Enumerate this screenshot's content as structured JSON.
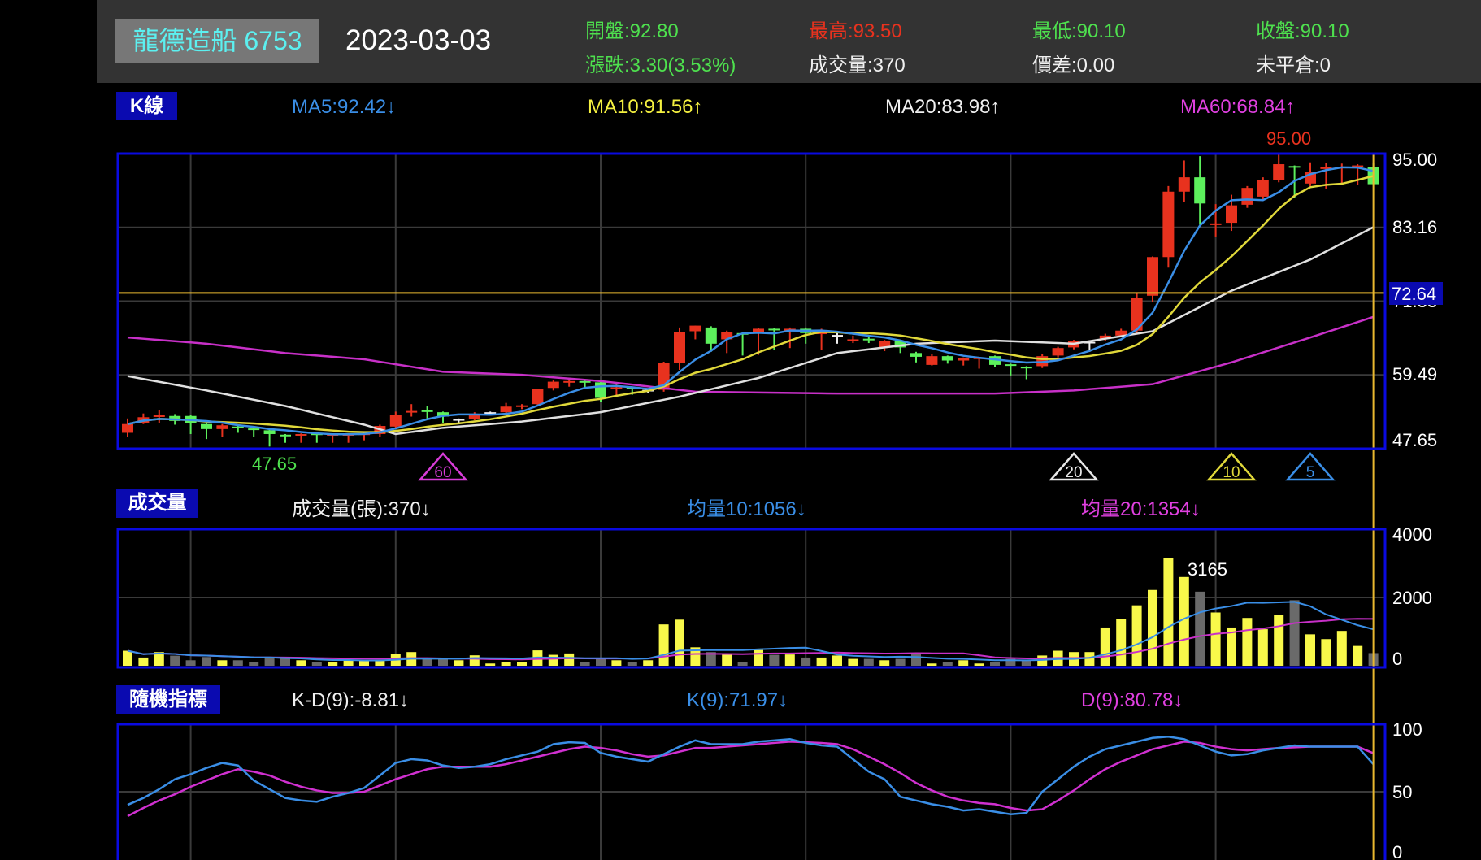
{
  "header": {
    "name": "龍德造船 6753",
    "date": "2023-03-03",
    "open": "開盤:92.80",
    "change": "漲跌:3.30(3.53%)",
    "high": "最高:93.50",
    "volume": "成交量:370",
    "low": "最低:90.10",
    "spread": "價差:0.00",
    "close": "收盤:90.10",
    "open_interest": "未平倉:0"
  },
  "kline_panel": {
    "tab": "K線",
    "ma5": "MA5:92.42↓",
    "ma10": "MA10:91.56↑",
    "ma20": "MA20:83.98↑",
    "ma60": "MA60:68.84↑",
    "y_ticks": [
      "95.00",
      "83.16",
      "71.33",
      "59.49",
      "47.65"
    ],
    "crosshair_value": "72.64",
    "max_label": "95.00",
    "min_label": "47.65",
    "markers": [
      {
        "label": "60",
        "index": 20,
        "color": "#d83cd8"
      },
      {
        "label": "20",
        "index": 60,
        "color": "#e8e8e8"
      },
      {
        "label": "10",
        "index": 70,
        "color": "#e0d83a"
      },
      {
        "label": "5",
        "index": 75,
        "color": "#3a8ee6"
      }
    ]
  },
  "volume_panel": {
    "tab": "成交量",
    "vol": "成交量(張):370↓",
    "avg10": "均量10:1056↓",
    "avg20": "均量20:1354↓",
    "y_ticks": [
      "4000",
      "2000",
      "0"
    ],
    "peak_label": "3165"
  },
  "kd_panel": {
    "tab": "隨機指標",
    "kd_diff": "K-D(9):-8.81↓",
    "k": "K(9):71.97↓",
    "d": "D(9):80.78↓",
    "y_ticks": [
      "100",
      "50",
      "0"
    ]
  },
  "colors": {
    "up": "#e8321e",
    "down": "#5cf05c",
    "flat": "#f0f0f0",
    "ma5": "#3a8ee6",
    "ma10": "#e0d83a",
    "ma20": "#e0e0e0",
    "ma60": "#c830c8",
    "vol_up": "#f8f84a",
    "vol_down": "#6a6a6a",
    "crosshair": "#e8b830",
    "frame": "#0a0ae0",
    "grid": "#3a3a3a"
  },
  "chart_data": {
    "type": "candlestick",
    "price_range": [
      47.65,
      95.0
    ],
    "crosshair_price": 72.64,
    "candles": [
      [
        50.2,
        52.5,
        49.5,
        51.6
      ],
      [
        51.8,
        53.3,
        51.6,
        52.7
      ],
      [
        52.8,
        53.8,
        51.7,
        53.0
      ],
      [
        52.9,
        53.2,
        51.5,
        52.1
      ],
      [
        52.9,
        53.1,
        50.0,
        51.8
      ],
      [
        51.6,
        51.8,
        49.2,
        50.8
      ],
      [
        50.8,
        51.6,
        49.5,
        51.4
      ],
      [
        51.2,
        51.3,
        50.2,
        51.0
      ],
      [
        50.9,
        51.0,
        49.6,
        50.8
      ],
      [
        50.6,
        50.7,
        48.0,
        50.0
      ],
      [
        49.9,
        50.0,
        48.6,
        49.8
      ],
      [
        49.8,
        50.1,
        48.6,
        50.0
      ],
      [
        50.1,
        50.2,
        48.6,
        50.0
      ],
      [
        49.9,
        50.1,
        48.6,
        50.0
      ],
      [
        49.9,
        50.1,
        48.6,
        50.0
      ],
      [
        49.9,
        50.2,
        49.0,
        50.1
      ],
      [
        50.0,
        51.5,
        49.6,
        51.3
      ],
      [
        51.2,
        53.6,
        51.0,
        53.1
      ],
      [
        53.5,
        54.8,
        52.8,
        53.7
      ],
      [
        53.8,
        54.5,
        52.5,
        53.7
      ],
      [
        53.5,
        53.6,
        51.8,
        52.8
      ],
      [
        52.4,
        52.5,
        51.7,
        52.4
      ],
      [
        52.4,
        53.5,
        52.2,
        53.1
      ],
      [
        53.5,
        53.6,
        53.0,
        53.5
      ],
      [
        53.5,
        55.0,
        53.3,
        54.4
      ],
      [
        54.4,
        54.8,
        54.0,
        54.6
      ],
      [
        54.8,
        57.3,
        54.7,
        57.2
      ],
      [
        57.4,
        58.6,
        57.0,
        58.4
      ],
      [
        58.4,
        58.9,
        57.6,
        58.5
      ],
      [
        58.5,
        58.8,
        57.4,
        58.4
      ],
      [
        58.3,
        58.6,
        55.2,
        55.8
      ],
      [
        57.4,
        58.3,
        56.2,
        57.5
      ],
      [
        57.5,
        57.6,
        56.3,
        57.4
      ],
      [
        57.1,
        57.3,
        56.6,
        57.1
      ],
      [
        57.1,
        61.6,
        56.8,
        61.4
      ],
      [
        61.4,
        67.1,
        60.3,
        66.4
      ],
      [
        66.5,
        67.4,
        65.2,
        67.4
      ],
      [
        67.1,
        67.3,
        63.2,
        64.5
      ],
      [
        65.2,
        66.6,
        63.0,
        66.4
      ],
      [
        66.2,
        66.4,
        62.6,
        66.1
      ],
      [
        66.4,
        67.0,
        62.7,
        66.9
      ],
      [
        66.9,
        67.0,
        63.5,
        66.8
      ],
      [
        66.6,
        67.1,
        63.8,
        66.9
      ],
      [
        66.9,
        67.1,
        64.5,
        66.2
      ],
      [
        66.2,
        66.9,
        63.5,
        66.3
      ],
      [
        65.9,
        66.3,
        64.5,
        65.9
      ],
      [
        65.1,
        65.8,
        64.6,
        65.2
      ],
      [
        65.3,
        65.8,
        64.6,
        65.2
      ],
      [
        63.9,
        65.1,
        63.3,
        64.9
      ],
      [
        64.9,
        65.1,
        63.0,
        63.9
      ],
      [
        63.0,
        63.2,
        61.5,
        62.4
      ],
      [
        61.1,
        62.8,
        61.0,
        62.5
      ],
      [
        62.5,
        62.6,
        61.3,
        61.8
      ],
      [
        61.8,
        62.3,
        61.0,
        62.2
      ],
      [
        62.2,
        62.4,
        60.5,
        62.3
      ],
      [
        62.5,
        62.6,
        60.8,
        61.1
      ],
      [
        61.2,
        61.3,
        59.4,
        61.1
      ],
      [
        60.8,
        60.9,
        58.8,
        60.7
      ],
      [
        60.9,
        62.8,
        60.6,
        62.5
      ],
      [
        62.6,
        64.0,
        62.3,
        63.8
      ],
      [
        63.9,
        65.1,
        63.6,
        64.9
      ],
      [
        64.8,
        65.0,
        63.2,
        64.8
      ],
      [
        65.3,
        66.1,
        64.9,
        65.8
      ],
      [
        65.8,
        66.9,
        65.6,
        66.6
      ],
      [
        66.6,
        72.7,
        66.0,
        71.8
      ],
      [
        72.2,
        78.5,
        71.2,
        78.4
      ],
      [
        78.4,
        89.8,
        76.7,
        88.9
      ],
      [
        88.9,
        93.9,
        87.2,
        91.2
      ],
      [
        91.2,
        94.6,
        83.6,
        87.0
      ],
      [
        83.7,
        86.9,
        81.7,
        83.8
      ],
      [
        83.9,
        88.4,
        82.6,
        86.7
      ],
      [
        86.8,
        89.8,
        86.3,
        89.5
      ],
      [
        88.1,
        91.2,
        87.6,
        90.7
      ],
      [
        90.7,
        95.0,
        90.4,
        93.3
      ],
      [
        93.0,
        93.1,
        87.9,
        92.9
      ],
      [
        90.2,
        93.6,
        89.8,
        92.1
      ],
      [
        92.7,
        93.5,
        89.4,
        92.8
      ],
      [
        92.8,
        93.4,
        90.2,
        92.9
      ],
      [
        93.0,
        93.3,
        90.0,
        93.1
      ],
      [
        92.8,
        93.5,
        90.1,
        90.1
      ]
    ],
    "ma20_points": [
      [
        0,
        59.3
      ],
      [
        5,
        57
      ],
      [
        10,
        54.5
      ],
      [
        15,
        51.5
      ],
      [
        17,
        50
      ],
      [
        20,
        51
      ],
      [
        25,
        52
      ],
      [
        30,
        53.5
      ],
      [
        35,
        56
      ],
      [
        40,
        59
      ],
      [
        45,
        63
      ],
      [
        50,
        64.5
      ],
      [
        55,
        65
      ],
      [
        60,
        64.5
      ],
      [
        65,
        66.5
      ],
      [
        70,
        73
      ],
      [
        75,
        78
      ],
      [
        79,
        83.2
      ]
    ],
    "ma60_points": [
      [
        0,
        65.5
      ],
      [
        5,
        64.5
      ],
      [
        10,
        63
      ],
      [
        15,
        62
      ],
      [
        20,
        60
      ],
      [
        25,
        59.5
      ],
      [
        30,
        58.5
      ],
      [
        36,
        56.8
      ],
      [
        45,
        56.5
      ],
      [
        55,
        56.5
      ],
      [
        60,
        57
      ],
      [
        65,
        58
      ],
      [
        70,
        61.5
      ],
      [
        75,
        65.5
      ],
      [
        79,
        68.8
      ]
    ],
    "volume": [
      440,
      240,
      400,
      295,
      160,
      255,
      160,
      160,
      100,
      225,
      225,
      160,
      100,
      110,
      160,
      160,
      160,
      350,
      400,
      225,
      225,
      160,
      305,
      65,
      110,
      110,
      450,
      320,
      360,
      110,
      210,
      160,
      110,
      160,
      1210,
      1350,
      540,
      400,
      330,
      110,
      460,
      320,
      330,
      240,
      240,
      300,
      200,
      200,
      160,
      200,
      360,
      65,
      100,
      160,
      65,
      100,
      200,
      160,
      300,
      440,
      400,
      400,
      1120,
      1360,
      1770,
      2220,
      3165,
      2600,
      2170,
      1560,
      1120,
      1400,
      1070,
      1500,
      1920,
      920,
      780,
      1020,
      580,
      370
    ],
    "volume_range": [
      0,
      4000
    ],
    "k": [
      39.5,
      45,
      52,
      60,
      64,
      69,
      73,
      71,
      59,
      52,
      45,
      43,
      42,
      46,
      49,
      53,
      63,
      73,
      76,
      75,
      71,
      69,
      70,
      72,
      76,
      79,
      82,
      88,
      89.5,
      89,
      81,
      78,
      76,
      74,
      80,
      86,
      91,
      88,
      88,
      88,
      90,
      91,
      92,
      89,
      87,
      86,
      76,
      66,
      60,
      46,
      43,
      40,
      38,
      35,
      36,
      34,
      32,
      33,
      50,
      60,
      70,
      78,
      84,
      87,
      90,
      93,
      94,
      92,
      87,
      82,
      79,
      80,
      83,
      85,
      87,
      86,
      86,
      86,
      86,
      72
    ],
    "d": [
      30.5,
      37,
      43,
      48,
      54,
      59,
      64,
      68,
      66,
      63,
      58,
      54,
      51,
      49,
      49,
      50,
      55,
      60,
      64,
      68,
      70,
      70,
      70,
      70,
      72,
      75,
      78,
      81,
      84,
      86,
      85,
      83,
      80,
      78,
      79,
      82,
      85,
      85,
      86,
      87,
      88,
      89,
      90,
      89.5,
      89,
      88,
      84,
      78,
      72,
      65,
      57,
      51,
      46,
      43,
      41,
      40,
      37,
      35,
      36,
      43,
      51,
      60,
      68,
      74,
      79,
      84,
      87,
      90,
      89,
      86,
      84,
      83,
      84,
      85,
      85.5,
      86,
      86,
      86,
      86,
      80.8
    ],
    "kd_range": [
      0,
      100
    ]
  }
}
